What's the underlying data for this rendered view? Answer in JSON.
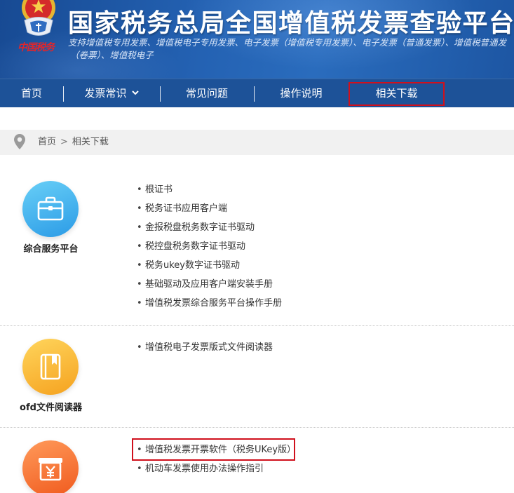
{
  "theme": {
    "header_blue": "#2462b3",
    "nav_blue": "#1d5298",
    "highlight_red": "#d0101c",
    "breadcrumb_bg": "#f1f1f1"
  },
  "header": {
    "emblem_icon": "national-emblem-icon",
    "logo_text": "中国税务",
    "title": "国家税务总局全国增值税发票查验平台",
    "subtitle_line1": "支持增值税专用发票、增值税电子专用发票、电子发票（增值税专用发票）、电子发票（普通发票）、增值税普通发",
    "subtitle_line2": "（卷票）、增值税电子"
  },
  "nav": {
    "items": [
      {
        "label": "首页"
      },
      {
        "label": "发票常识",
        "has_dropdown": true,
        "icon": "chevron-down-icon"
      },
      {
        "label": "常见问题"
      },
      {
        "label": "操作说明"
      },
      {
        "label": "相关下载",
        "active": true,
        "highlighted": true
      }
    ]
  },
  "breadcrumb": {
    "icon": "location-pin-icon",
    "home": "首页",
    "separator": ">",
    "current": "相关下载"
  },
  "sections": [
    {
      "label": "综合服务平台",
      "icon": "briefcase-icon",
      "icon_colors": [
        "#68cff7",
        "#2b9be6"
      ],
      "links": [
        {
          "text": "根证书"
        },
        {
          "text": "税务证书应用客户端"
        },
        {
          "text": "金报税盘税务数字证书驱动"
        },
        {
          "text": "税控盘税务数字证书驱动"
        },
        {
          "text": "税务ukey数字证书驱动"
        },
        {
          "text": "基础驱动及应用客户端安装手册"
        },
        {
          "text": "增值税发票综合服务平台操作手册"
        }
      ]
    },
    {
      "label": "ofd文件阅读器",
      "icon": "book-icon",
      "icon_colors": [
        "#ffd55c",
        "#f5a21f"
      ],
      "links": [
        {
          "text": "增值税电子发票版式文件阅读器"
        }
      ]
    },
    {
      "icon": "invoice-yuan-icon",
      "icon_colors": [
        "#ff9a5a",
        "#f05a1e"
      ],
      "links": [
        {
          "text": "增值税发票开票软件（税务UKey版）",
          "highlighted": true
        },
        {
          "text": "机动车发票使用办法操作指引"
        }
      ]
    }
  ]
}
